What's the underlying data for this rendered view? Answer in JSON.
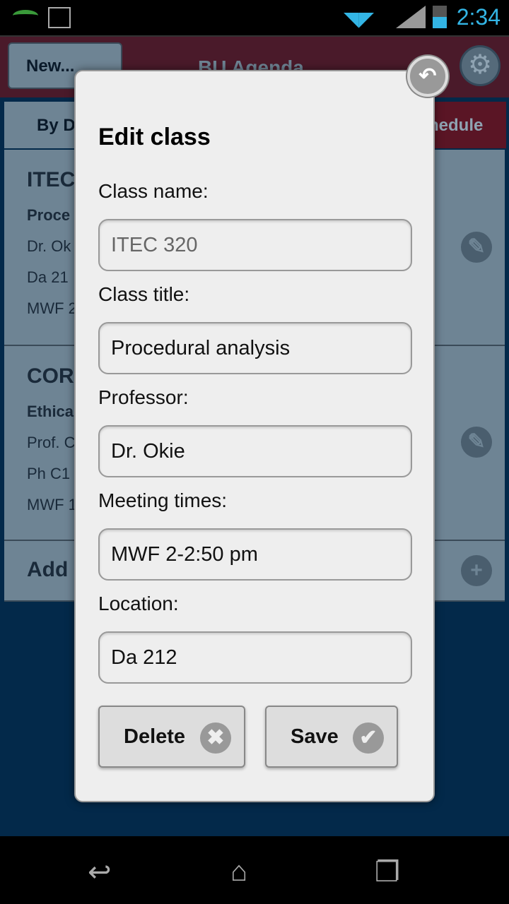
{
  "status_bar": {
    "time": "2:34",
    "icons": [
      "phone-call-icon",
      "image-icon",
      "wifi-icon",
      "signal-icon",
      "battery-icon"
    ]
  },
  "app_bar": {
    "new_button": "New...",
    "title": "BU Agenda"
  },
  "tabs": [
    {
      "label": "By D"
    },
    {
      "label": "hedule"
    }
  ],
  "cards": [
    {
      "title": "ITEC",
      "subtitle": "Proce",
      "lines": [
        "Dr. Ok",
        "Da 21",
        "MWF 2"
      ]
    },
    {
      "title": "CORE",
      "subtitle": "Ethica",
      "lines": [
        "Prof. C",
        "Ph C1",
        "MWF 1"
      ]
    }
  ],
  "add_row": {
    "label": "Add"
  },
  "dialog": {
    "title": "Edit class",
    "fields": [
      {
        "label": "Class name:",
        "value": "ITEC 320"
      },
      {
        "label": "Class title:",
        "value": "Procedural analysis"
      },
      {
        "label": "Professor:",
        "value": "Dr. Okie"
      },
      {
        "label": "Meeting times:",
        "value": "MWF 2-2:50 pm"
      },
      {
        "label": "Location:",
        "value": "Da 212"
      }
    ],
    "delete_label": "Delete",
    "save_label": "Save"
  },
  "colors": {
    "app_bar": "#4a1a2a",
    "card": "#6e8494",
    "background": "#03294a",
    "accent": "#33b5e5"
  }
}
